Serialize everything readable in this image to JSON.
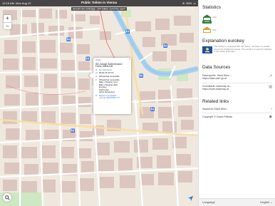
{
  "status_bar": {
    "time": "12:18 AM",
    "date": "Mon Aug 12",
    "battery": "55%"
  },
  "map": {
    "title": "Public Toilets in Vienna",
    "subtitle": "Anzahl der Einträge: 184 toilets currently open",
    "zoom_in": "+",
    "zoom_out": "−"
  },
  "popup": {
    "close": "×",
    "type": "Urban",
    "title": "WC-Anlage Salztorbrücke / Franz-Josefs-Kai",
    "directions": "Get directions",
    "hours": "00:00-24:00 Uhr",
    "category": "Wheelchair accessible",
    "features": [
      "Wheelchair accessible",
      "Baby changing room",
      "Baby changing table",
      "Eurokey",
      "Night toilet",
      "Hand disinfection"
    ],
    "report": "Report a complaint",
    "phone": "+43 (1) 4000 8033 777"
  },
  "sidebar": {
    "statistics_title": "Statistics",
    "legend": [
      {
        "label": "Urbz",
        "badge": "OPEN"
      },
      {
        "label": "Urbz",
        "badge": ""
      }
    ],
    "eurokey_title": "Explanation eurokey",
    "eurokey_text": "This facility is equipped with the \"EKey - eurokey\" to enable access for disabled persons. The eurokey is used for facilities in the whole of Europe.",
    "datasources_title": "Data Sources",
    "datasources": [
      {
        "name": "Datenquelle: Stadt Wien –",
        "url": "https://data.wien.gv.at",
        "icon": "chart-trend-icon"
      },
      {
        "name": "Grundkarte: basemap.at –",
        "url": "https://www.basemap.at",
        "icon": "map-icon"
      }
    ],
    "links_title": "Related links",
    "links": [
      {
        "label": "Sauberes Stadt Wien",
        "icon": "chevron-right-icon"
      },
      {
        "label": "Copyright © David Pelikan",
        "icon": "github-icon"
      }
    ],
    "language_label": "Language",
    "language_value": "English"
  },
  "colors": {
    "park": "#cfe8c4",
    "water": "#a7d0ee",
    "building": "#dcc6c0",
    "road": "#ffffff",
    "accent": "#2b6fc2"
  }
}
